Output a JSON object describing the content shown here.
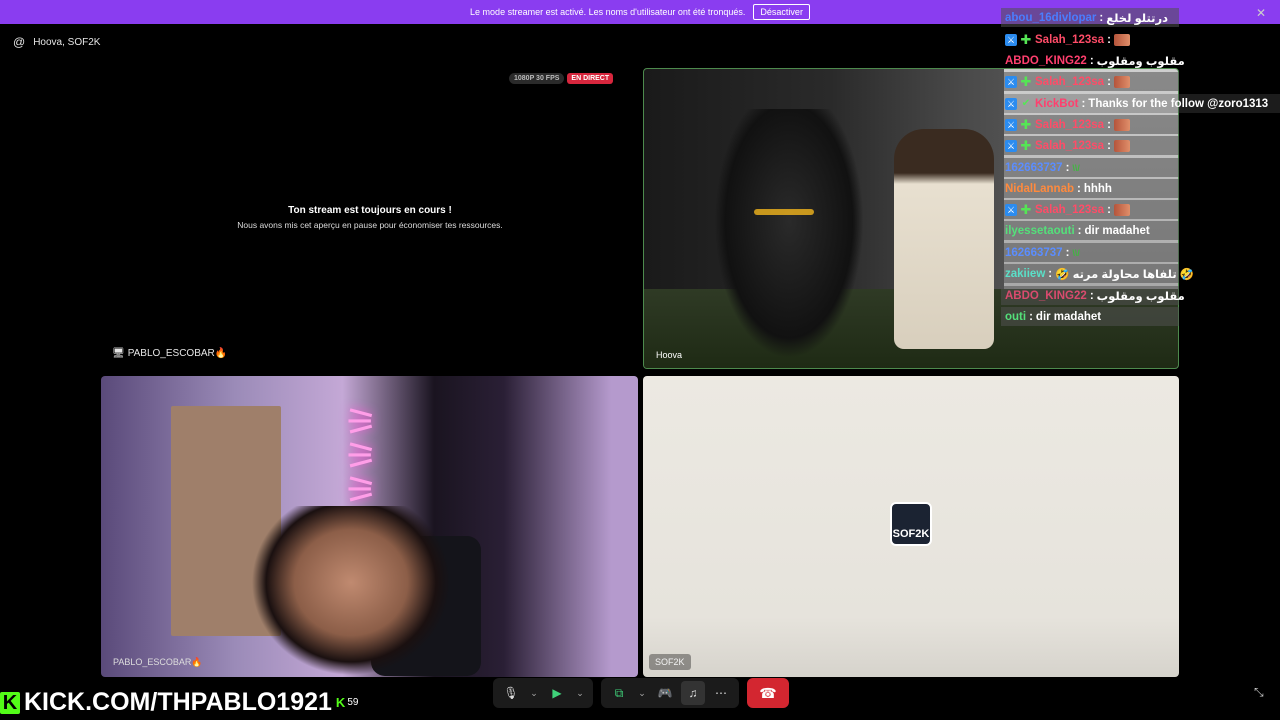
{
  "banner": {
    "text": "Le mode streamer est activé. Les noms d'utilisateur ont été tronqués.",
    "button": "Désactiver"
  },
  "room": {
    "title": "Hoova, SOF2K"
  },
  "stream": {
    "quality": "1080P 30 FPS",
    "live": "EN DIRECT",
    "paused_title": "Ton stream est toujours en cours !",
    "paused_sub": "Nous avons mis cet aperçu en pause pour économiser tes ressources."
  },
  "tiles": {
    "hoova": {
      "label": "Hoova"
    },
    "pablo": {
      "header": "PABLO_ESCOBAR🔥",
      "label": "PABLO_ESCOBAR🔥"
    },
    "sof2k": {
      "label": "SOF2K",
      "logo": "SOF2K"
    }
  },
  "chat": [
    {
      "user": "abou_16divlopar",
      "msg": "درتتلو لخلع",
      "color": "u1",
      "badges": [],
      "bg": "bg"
    },
    {
      "user": "Salah_123sa",
      "msg": "",
      "color": "u2",
      "badges": [
        "a",
        "b"
      ],
      "emote": "red",
      "bg": ""
    },
    {
      "user": "ABDO_KING22",
      "msg": "مقلوب ومقلوب",
      "color": "u3",
      "badges": [],
      "bg": ""
    },
    {
      "user": "Salah_123sa",
      "msg": "",
      "color": "u2",
      "badges": [
        "a",
        "b"
      ],
      "emote": "red",
      "bg": "bg"
    },
    {
      "user": "KickBot",
      "msg": "Thanks for the follow @zoro1313",
      "color": "u3",
      "badges": [
        "a",
        "c"
      ],
      "bg": "bg wide"
    },
    {
      "user": "Salah_123sa",
      "msg": "",
      "color": "u2",
      "badges": [
        "a",
        "b"
      ],
      "emote": "red",
      "bg": "bg"
    },
    {
      "user": "Salah_123sa",
      "msg": "",
      "color": "u2",
      "badges": [
        "a",
        "b"
      ],
      "emote": "red",
      "bg": "bg"
    },
    {
      "user": "162663737",
      "msg": "",
      "color": "u4",
      "badges": [],
      "emote": "green",
      "bg": "bg"
    },
    {
      "user": "NidalLannab",
      "msg": "hhhh",
      "color": "u5",
      "badges": [],
      "bg": "bg"
    },
    {
      "user": "Salah_123sa",
      "msg": "",
      "color": "u2",
      "badges": [
        "a",
        "b"
      ],
      "emote": "red",
      "bg": "bg"
    },
    {
      "user": "ilyessetaouti",
      "msg": "dir madahet",
      "color": "u8",
      "badges": [],
      "bg": "bg"
    },
    {
      "user": "162663737",
      "msg": "",
      "color": "u4",
      "badges": [],
      "emote": "green",
      "bg": "bg"
    },
    {
      "user": "zakiiew",
      "msg": "🤣 تلفاها محاولة مرته 🤣",
      "color": "u6",
      "badges": [],
      "bg": "bg"
    },
    {
      "user": "ABDO_KING22",
      "msg": "مقلوب ومقلوب",
      "color": "u7",
      "badges": [],
      "bg": "bg"
    },
    {
      "user": "outi",
      "msg": "dir madahet",
      "color": "u8",
      "badges": [],
      "bg": "bg"
    }
  ],
  "brand": {
    "url": "KICK.COM/THPABLO1921",
    "viewers": "59",
    "logo": "K"
  },
  "colors": {
    "banner": "#8a3df0",
    "kick_green": "#53fc18",
    "hangup": "#d32630"
  }
}
